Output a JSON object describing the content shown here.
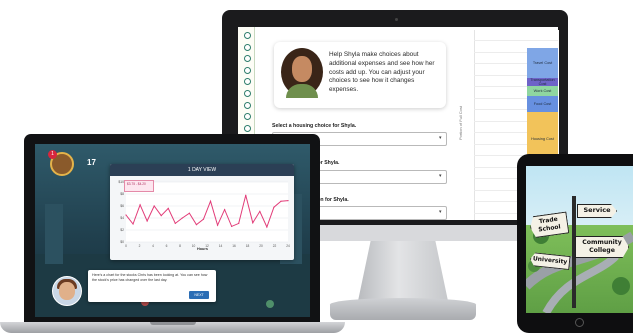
{
  "monitor": {
    "intro_text": "Help Shyla make choices about additional expenses and see how her costs add up. You can adjust your choices to see how it changes expenses.",
    "questions": [
      {
        "label": "Select a housing choice for Shyla.",
        "value": "Housing choices"
      },
      {
        "label": "ation for Shyla.",
        "value": ""
      },
      {
        "label": "uation for Shyla.",
        "value": ""
      }
    ],
    "chart_axis_label": "Portion of Full Cost",
    "stack": [
      {
        "label": "Travel Cost",
        "color": "#7fa6e6"
      },
      {
        "label": "Transportation Cost",
        "color": "#6e63c8"
      },
      {
        "label": "Work Cost",
        "color": "#8fd6a0"
      },
      {
        "label": "Food Cost",
        "color": "#6790e0"
      },
      {
        "label": "Housing Cost",
        "color": "#f2c35a"
      }
    ]
  },
  "laptop": {
    "day_number": "17",
    "notification_badge": "1",
    "chart": {
      "title": "1 DAY VIEW",
      "tooltip": "$3.75 - $4.20",
      "x_title": "Hours",
      "y_ticks": [
        "$10",
        "$8",
        "$6",
        "$4",
        "$2",
        "$0"
      ],
      "x_ticks": [
        "0",
        "2",
        "4",
        "6",
        "8",
        "10",
        "12",
        "14",
        "16",
        "18",
        "20",
        "22",
        "24"
      ]
    },
    "message": "Here's a chart for the stocks Chris has been looking at. You can see how the stock's price has changed over the last day.",
    "next_label": "NEXT"
  },
  "tablet": {
    "signs": [
      "Trade School",
      "Service",
      "Community College",
      "University"
    ]
  },
  "chart_data": {
    "type": "line",
    "title": "1 DAY VIEW",
    "xlabel": "Hours",
    "ylabel": "",
    "ylim": [
      0,
      10
    ],
    "series": [
      {
        "name": "",
        "color": "#e23d79",
        "values": [
          4.5,
          3.0,
          6.2,
          3.5,
          6.0,
          4.4,
          5.6,
          3.1,
          4.0,
          4.8,
          2.9,
          3.8,
          6.8,
          2.8,
          5.4,
          2.6,
          3.1,
          7.8,
          3.2,
          5.1,
          2.5,
          5.8,
          6.8,
          6.9
        ]
      }
    ]
  }
}
